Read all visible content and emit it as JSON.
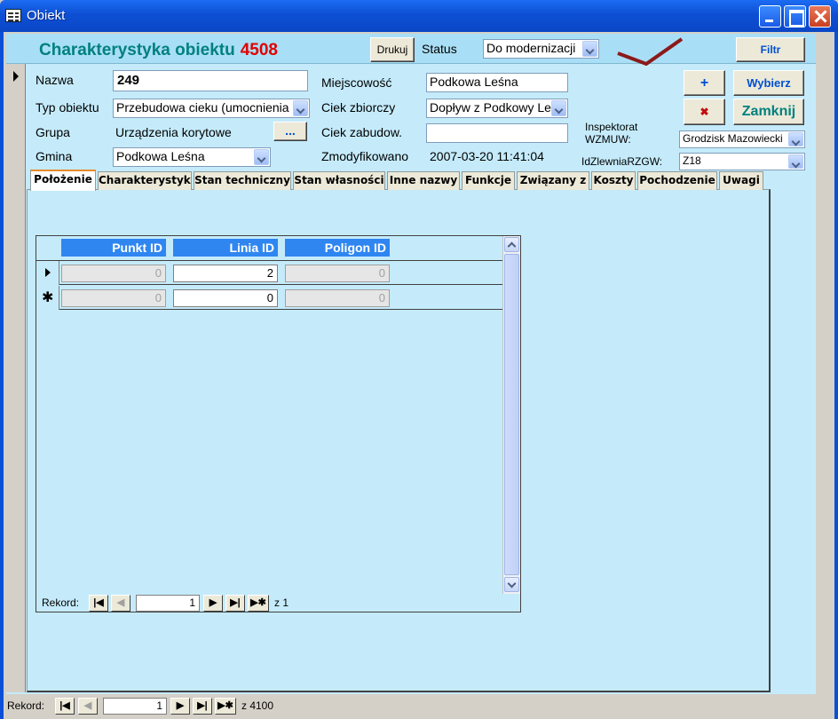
{
  "window": {
    "title": "Obiekt"
  },
  "header": {
    "title": "Charakterystyka obiektu",
    "object_number": "4508",
    "print_label": "Drukuj",
    "status_label": "Status",
    "status_value": "Do modernizacji",
    "filter_label": "Filtr"
  },
  "fields": {
    "nazwa_label": "Nazwa",
    "nazwa_value": "249",
    "typ_label": "Typ obiektu",
    "typ_value": "Przebudowa cieku (umocnienia",
    "grupa_label": "Grupa",
    "grupa_value": "Urządzenia korytowe",
    "grupa_button": "...",
    "gmina_label": "Gmina",
    "gmina_value": "Podkowa Leśna",
    "miejscowosc_label": "Miejscowość",
    "miejscowosc_value": "Podkowa Leśna",
    "ciek_zbiorczy_label": "Ciek zbiorczy",
    "ciek_zbiorczy_value": "Dopływ z Podkowy Le",
    "ciek_zabudow_label": "Ciek zabudow.",
    "ciek_zabudow_value": "",
    "zmodyfikowano_label": "Zmodyfikowano",
    "zmodyfikowano_value": "2007-03-20 11:41:04",
    "inspektorat_label_1": "Inspektorat",
    "inspektorat_label_2": "WZMUW:",
    "inspektorat_value": "Grodzisk Mazowiecki",
    "idzlewnia_label": "IdZlewniaRZGW:",
    "idzlewnia_value": "Z18"
  },
  "actions": {
    "add_label": "+",
    "select_label": "Wybierz",
    "delete_label": "✖",
    "close_label": "Zamknij"
  },
  "tabs": [
    {
      "label": "Położenie"
    },
    {
      "label": "Charakterystyka"
    },
    {
      "label": "Stan techniczny"
    },
    {
      "label": "Stan własności"
    },
    {
      "label": "Inne nazwy"
    },
    {
      "label": "Funkcje"
    },
    {
      "label": "Związany z"
    },
    {
      "label": "Koszty"
    },
    {
      "label": "Pochodzenie"
    },
    {
      "label": "Uwagi"
    }
  ],
  "subform": {
    "columns": [
      "Punkt ID",
      "Linia ID",
      "Poligon ID"
    ],
    "rows": [
      {
        "punkt": "0",
        "linia": "2",
        "poligon": "0"
      },
      {
        "punkt": "0",
        "linia": "0",
        "poligon": "0"
      }
    ],
    "nav": {
      "label": "Rekord:",
      "current": "1",
      "of_text": "z 1"
    }
  },
  "main_nav": {
    "label": "Rekord:",
    "current": "1",
    "of_text": "z 4100"
  },
  "colors": {
    "title_teal": "#008080",
    "title_red": "#e00000",
    "form_bg": "#c5ebfb",
    "column_header": "#2f86f0"
  }
}
